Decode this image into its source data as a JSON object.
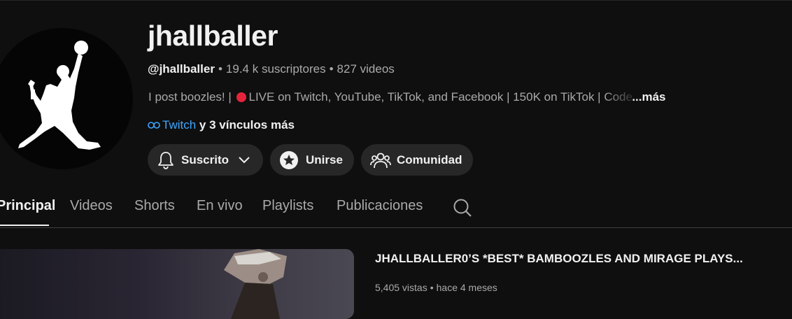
{
  "channel": {
    "name": "jhallballer",
    "handle": "@jhallballer",
    "subscribers": "19.4 k suscriptores",
    "videos": "827 videos",
    "separator": "•",
    "description_prefix": "I post boozles! |",
    "description_main": "LIVE on Twitch, YouTube, TikTok, and Facebook | 150K on TikTok |",
    "description_faded": "Code",
    "description_more": "...más",
    "link_primary": "Twitch",
    "link_more": "y 3 vínculos más"
  },
  "actions": {
    "subscribe_label": "Suscrito",
    "join_label": "Unirse",
    "community_label": "Comunidad"
  },
  "tabs": [
    {
      "label": "Principal",
      "active": true
    },
    {
      "label": "Videos",
      "active": false
    },
    {
      "label": "Shorts",
      "active": false
    },
    {
      "label": "En vivo",
      "active": false
    },
    {
      "label": "Playlists",
      "active": false
    },
    {
      "label": "Publicaciones",
      "active": false
    }
  ],
  "featured_video": {
    "title": "JHALLBALLER0’S *BEST* BAMBOOZLES AND MIRAGE PLAYS...",
    "views": "5,405 vistas",
    "age": "hace 4 meses"
  },
  "icons": {
    "bell": "bell-icon",
    "chevron": "chevron-down-icon",
    "star": "star-icon",
    "community": "people-icon",
    "search": "search-icon",
    "link": "link-icon",
    "live": "red-circle-emoji"
  },
  "colors": {
    "background": "#0f0f0f",
    "button": "#272727",
    "link": "#3ea6ff",
    "live": "#e5243b",
    "text_secondary": "#aaaaaa"
  }
}
